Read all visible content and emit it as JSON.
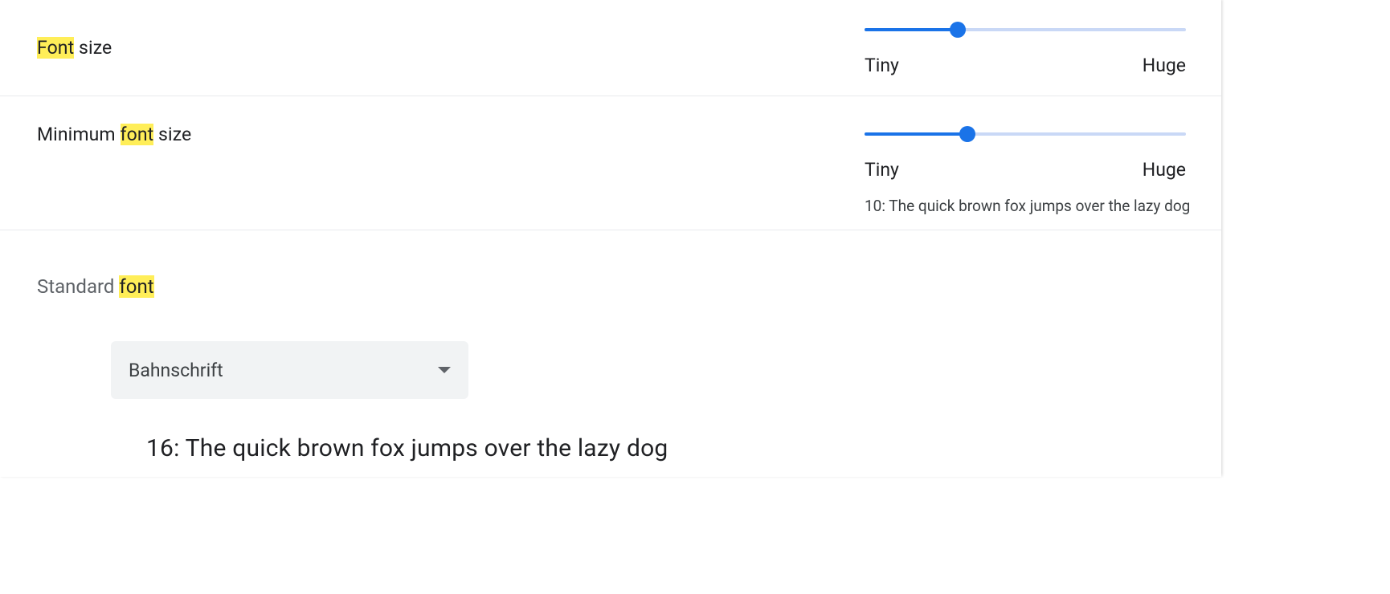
{
  "highlight_term": "font",
  "font_size": {
    "label_pre": "Font",
    "label_post": " size",
    "slider": {
      "min_label": "Tiny",
      "max_label": "Huge",
      "percent": 29
    }
  },
  "min_font_size": {
    "label_pre": "Minimum ",
    "label_hl": "font",
    "label_post": " size",
    "slider": {
      "min_label": "Tiny",
      "max_label": "Huge",
      "percent": 32
    },
    "sample": "10: The quick brown fox jumps over the lazy dog"
  },
  "standard_font": {
    "title_pre": "Standard ",
    "title_hl": "font",
    "selected": "Bahnschrift",
    "sample": "16: The quick brown fox jumps over the lazy dog"
  }
}
